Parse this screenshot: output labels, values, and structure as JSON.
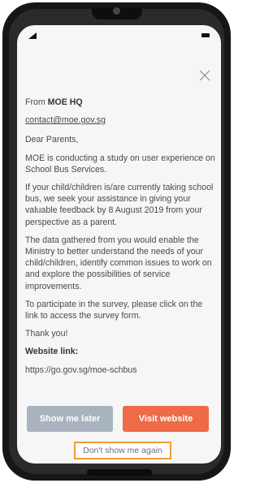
{
  "dialog": {
    "from_prefix": "From",
    "sender": "MOE HQ",
    "email": "contact@moe.gov.sg",
    "greeting": "Dear Parents,",
    "paragraphs": [
      "MOE is conducting a study on user experience on School Bus Services.",
      "If your child/children is/are currently taking school bus, we seek your assistance in giving your valuable feedback by 8 August 2019 from your perspective as a parent.",
      "The data gathered from you would enable the Ministry to better understand the needs of your child/children, identify common issues to work on and explore the possibilities of service improvements.",
      "To participate in the survey, please click on the link to access the survey form.",
      "Thank you!"
    ],
    "website_label": "Website link:",
    "website_url": "https://go.gov.sg/moe-schbus",
    "buttons": {
      "later": "Show me later",
      "visit": "Visit website"
    },
    "dont_show": "Don't show me again"
  },
  "icons": {
    "close": "close-icon",
    "signal": "signal-icon",
    "battery": "battery-icon"
  },
  "colors": {
    "primary_button": "#ef6a47",
    "secondary_button": "#a9b3c0",
    "highlight_outline": "#f39a3b"
  }
}
